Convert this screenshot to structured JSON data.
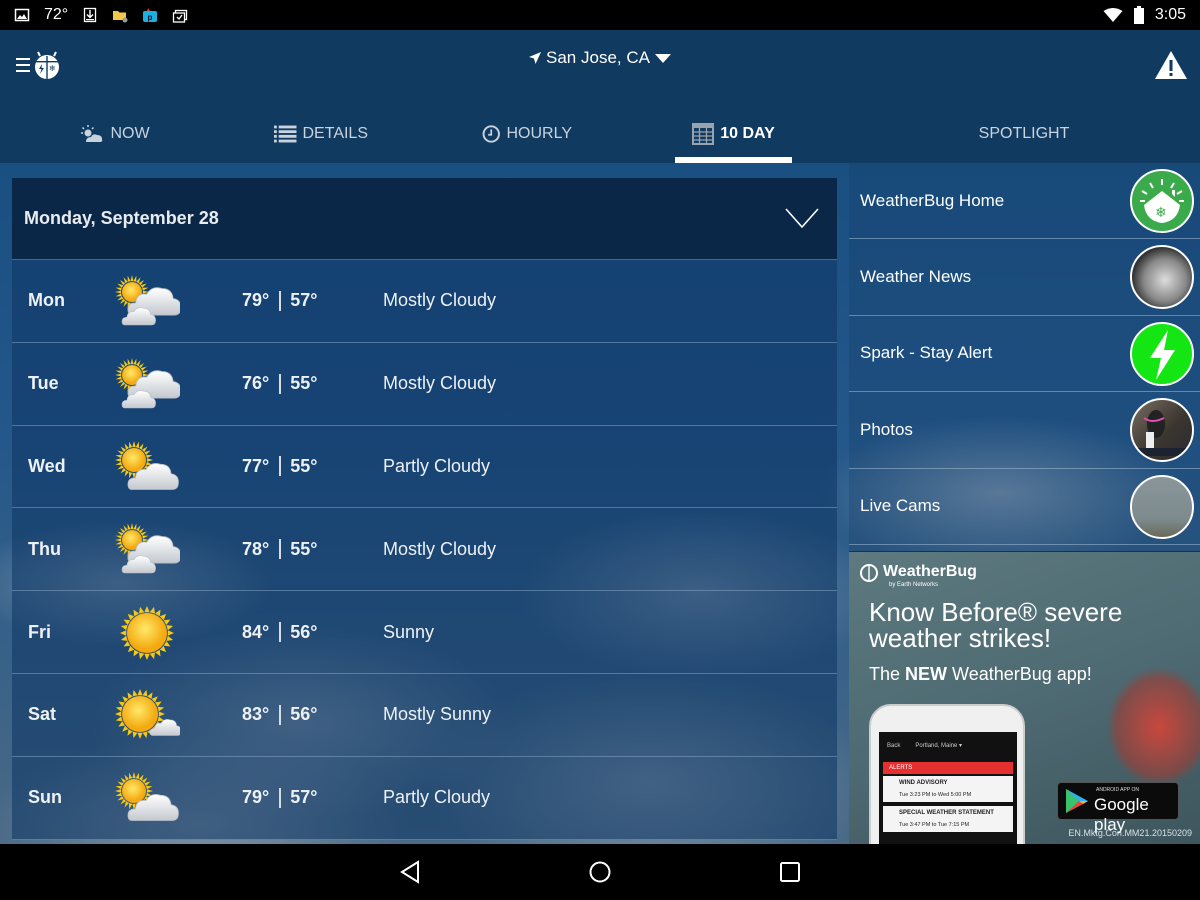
{
  "status_bar": {
    "temperature": "72°",
    "time": "3:05",
    "left_icons": [
      "image-icon",
      "download-icon",
      "folder-icon",
      "photo-editor-icon",
      "clipboard-check-icon"
    ],
    "right_icons": [
      "wifi-icon",
      "battery-icon"
    ]
  },
  "header": {
    "app_name": "WeatherBug",
    "location": "San Jose, CA",
    "menu_icon": "hamburger-icon",
    "alert_icon": "warning-icon"
  },
  "tabs": [
    {
      "label": "NOW",
      "icon": "partly-sunny-icon",
      "active": false
    },
    {
      "label": "DETAILS",
      "icon": "list-icon",
      "active": false
    },
    {
      "label": "HOURLY",
      "icon": "clock-icon",
      "active": false
    },
    {
      "label": "10 DAY",
      "icon": "calendar-grid-icon",
      "active": true
    },
    {
      "label": "SPOTLIGHT",
      "icon": "",
      "active": false
    }
  ],
  "forecast": {
    "date_header": "Monday, September 28",
    "days": [
      {
        "day": "Mon",
        "high": "79°",
        "low": "57°",
        "condition": "Mostly Cloudy",
        "icon": "mostly-cloudy"
      },
      {
        "day": "Tue",
        "high": "76°",
        "low": "55°",
        "condition": "Mostly Cloudy",
        "icon": "mostly-cloudy"
      },
      {
        "day": "Wed",
        "high": "77°",
        "low": "55°",
        "condition": "Partly Cloudy",
        "icon": "partly-cloudy"
      },
      {
        "day": "Thu",
        "high": "78°",
        "low": "55°",
        "condition": "Mostly Cloudy",
        "icon": "mostly-cloudy"
      },
      {
        "day": "Fri",
        "high": "84°",
        "low": "56°",
        "condition": "Sunny",
        "icon": "sunny"
      },
      {
        "day": "Sat",
        "high": "83°",
        "low": "56°",
        "condition": "Mostly Sunny",
        "icon": "mostly-sunny"
      },
      {
        "day": "Sun",
        "high": "79°",
        "low": "57°",
        "condition": "Partly Cloudy",
        "icon": "partly-cloudy"
      }
    ]
  },
  "spotlight": {
    "items": [
      {
        "label": "WeatherBug Home",
        "thumb": "weatherbug-home-icon",
        "color": "#3aaa4a"
      },
      {
        "label": "Weather News",
        "thumb": "weather-news-thumbnail",
        "color": "#777777"
      },
      {
        "label": "Spark - Stay Alert",
        "thumb": "lightning-bolt-icon",
        "color": "#14e614"
      },
      {
        "label": "Photos",
        "thumb": "photos-thumbnail",
        "color": "#5a5450"
      },
      {
        "label": "Live Cams",
        "thumb": "live-cams-thumbnail",
        "color": "#7d8a8e"
      }
    ]
  },
  "ad": {
    "logo": "WeatherBug",
    "logo_sub": "by Earth Networks",
    "headline": "Know Before® severe weather strikes!",
    "subline_pre": "The ",
    "subline_bold": "NEW",
    "subline_post": " WeatherBug app!",
    "phone": {
      "back": "Back",
      "location": "Portland, Maine",
      "alerts_label": "ALERTS",
      "alert1_title": "WIND ADVISORY",
      "alert1_time": "Tue 3:23 PM  to  Wed 5:00 PM",
      "alert2_title": "SPECIAL WEATHER STATEMENT",
      "alert2_time": "Tue 3:47 PM  to  Tue 7:15 PM"
    },
    "store_small": "ANDROID APP ON",
    "store_big": "Google play",
    "code": "EN.Mktg.Con.MM21.20150209"
  },
  "nav_bar": {
    "buttons": [
      "back-icon",
      "home-icon",
      "recents-icon"
    ]
  }
}
